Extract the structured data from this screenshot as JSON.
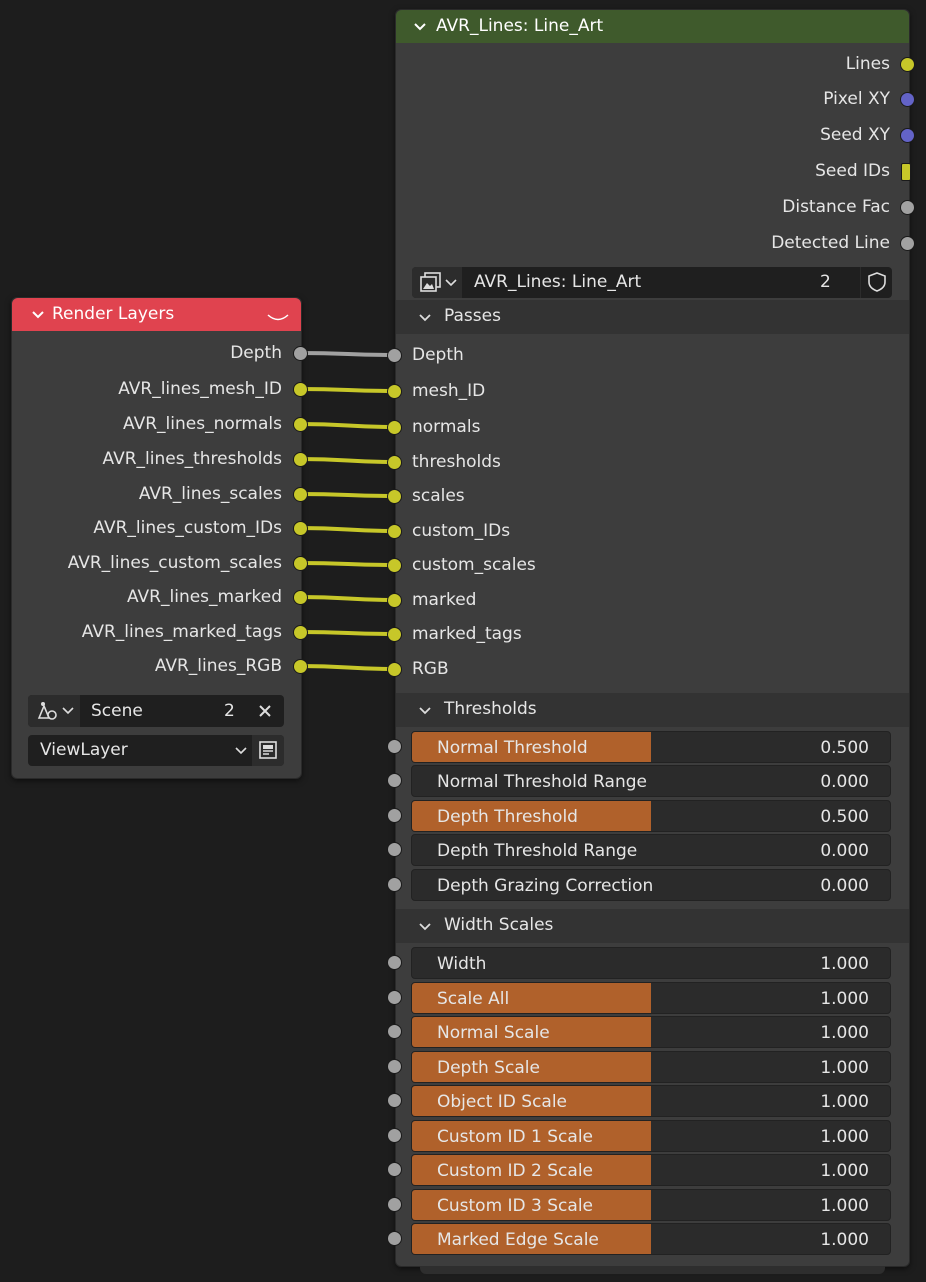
{
  "colors": {
    "background": "#1d1d1d",
    "node_body": "#3d3d3d",
    "render_layers_header": "#e0434f",
    "group_header": "#3f5a2c",
    "socket_float": "#a1a1a1",
    "socket_vector": "#6363c7",
    "socket_color": "#c7c729",
    "slider_fill": "#b0612b"
  },
  "render_layers": {
    "title": "Render Layers",
    "outputs": [
      "Depth",
      "AVR_lines_mesh_ID",
      "AVR_lines_normals",
      "AVR_lines_thresholds",
      "AVR_lines_scales",
      "AVR_lines_custom_IDs",
      "AVR_lines_custom_scales",
      "AVR_lines_marked",
      "AVR_lines_marked_tags",
      "AVR_lines_RGB"
    ],
    "scene": {
      "icon": "scene-icon",
      "name": "Scene",
      "users": "2"
    },
    "view_layer": {
      "name": "ViewLayer",
      "icon": "render-layers-icon"
    }
  },
  "group_node": {
    "title": "AVR_Lines: Line_Art",
    "outputs": [
      "Lines",
      "Pixel XY",
      "Seed XY",
      "Seed IDs",
      "Distance Fac",
      "Detected Line"
    ],
    "datablock": {
      "name": "AVR_Lines: Line_Art",
      "users": "2",
      "icon": "node-tree-icon"
    },
    "panels": {
      "passes": {
        "title": "Passes",
        "inputs": [
          "Depth",
          "mesh_ID",
          "normals",
          "thresholds",
          "scales",
          "custom_IDs",
          "custom_scales",
          "marked",
          "marked_tags",
          "RGB"
        ]
      },
      "thresholds": {
        "title": "Thresholds",
        "fields": [
          {
            "name": "Normal Threshold",
            "value": "0.500",
            "fill": 0.5
          },
          {
            "name": "Normal Threshold Range",
            "value": "0.000",
            "fill": 0
          },
          {
            "name": "Depth Threshold",
            "value": "0.500",
            "fill": 0.5
          },
          {
            "name": "Depth Threshold Range",
            "value": "0.000",
            "fill": 0
          },
          {
            "name": "Depth Grazing Correction",
            "value": "0.000",
            "fill": 0
          }
        ]
      },
      "width_scales": {
        "title": "Width Scales",
        "fields": [
          {
            "name": "Width",
            "value": "1.000",
            "fill": 0
          },
          {
            "name": "Scale All",
            "value": "1.000",
            "fill": 0.5
          },
          {
            "name": "Normal Scale",
            "value": "1.000",
            "fill": 0.5
          },
          {
            "name": "Depth Scale",
            "value": "1.000",
            "fill": 0.5
          },
          {
            "name": "Object ID Scale",
            "value": "1.000",
            "fill": 0.5
          },
          {
            "name": "Custom ID 1 Scale",
            "value": "1.000",
            "fill": 0.5
          },
          {
            "name": "Custom ID 2 Scale",
            "value": "1.000",
            "fill": 0.5
          },
          {
            "name": "Custom ID 3 Scale",
            "value": "1.000",
            "fill": 0.5
          },
          {
            "name": "Marked Edge Scale",
            "value": "1.000",
            "fill": 0.5
          }
        ]
      }
    }
  }
}
